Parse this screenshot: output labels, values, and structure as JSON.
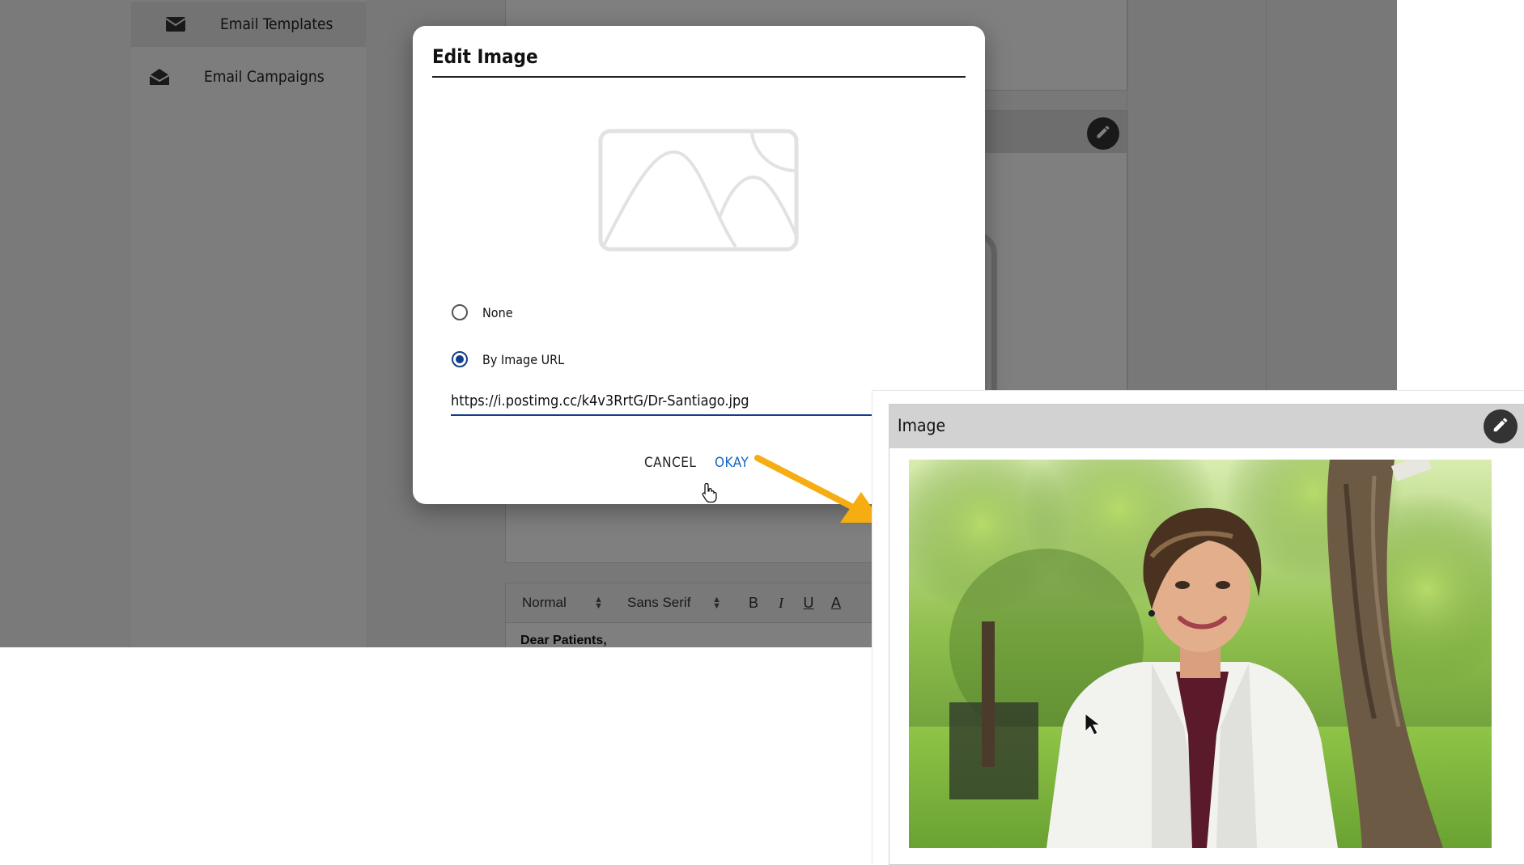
{
  "sidebar": {
    "items": [
      {
        "label": "Email Templates",
        "icon": "envelope-icon",
        "active": true
      },
      {
        "label": "Email Campaigns",
        "icon": "envelope-open-icon",
        "active": false
      }
    ]
  },
  "editor": {
    "format_select": "Normal",
    "font_select": "Sans Serif",
    "bold": "B",
    "italic": "I",
    "underline": "U",
    "color": "A",
    "body_text": "Dear Patients,"
  },
  "dialog": {
    "title": "Edit Image",
    "options": [
      {
        "label": "None",
        "selected": false
      },
      {
        "label": "By Image URL",
        "selected": true
      }
    ],
    "url_value": "https://i.postimg.cc/k4v3RrtG/Dr-Santiago.jpg",
    "cancel_label": "CANCEL",
    "okay_label": "OKAY"
  },
  "inset": {
    "title": "Image"
  },
  "colors": {
    "accent": "#123d8a",
    "link": "#1565c0",
    "arrow": "#f5ad12"
  }
}
